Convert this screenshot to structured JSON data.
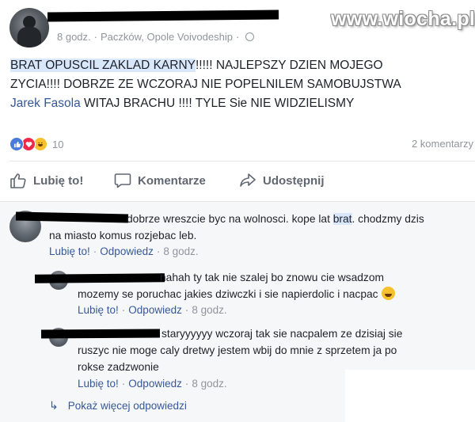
{
  "post": {
    "meta": {
      "time": "8 godz.",
      "separator": "·",
      "location": "Paczków, Opole Voivodeship",
      "extra_separator": "·"
    },
    "text": {
      "line1_highlight": "BRAT OPUSCIL ZAKLAD KARNY",
      "line1_rest": "!!!!! NAJLEPSZY DZIEN MOJEGO",
      "line2": "ZYCIA!!!! DOBRZE ZE WCZORAJ NIE POPELNILEM SAMOBUJSTWA",
      "line3_tag": "Jarek Fasola",
      "line3_rest": " WITAJ BRACHU !!!! TYLE Sie NIE WIDZIELISMY"
    },
    "reactions": {
      "icons": [
        "like-icon",
        "love-icon",
        "haha-icon"
      ],
      "count": "10"
    },
    "comments_count": "2 komentarzy"
  },
  "watermark": "www.wiocha.pl",
  "actions": {
    "like": "Lubię to!",
    "comment": "Komentarze",
    "share": "Udostępnij"
  },
  "comments": [
    {
      "line1_partial": "dobrze wreszcie byc na wolnosci. kope lat ",
      "line1_highlight": "brat",
      "line1_end": ". chodzmy dzis",
      "line2": "na miasto komus rozjebac leb.",
      "like": "Lubię to!",
      "reply": "Odpowiedz",
      "time": "8 godz."
    }
  ],
  "replies": [
    {
      "line1": "hahah ty tak nie szalej bo znowu cie wsadzom",
      "line2": "mozemy se poruchac jakies dziwczki i sie napierdolic i nacpac",
      "like": "Lubię to!",
      "reply": "Odpowiedz",
      "time": "8 godz."
    },
    {
      "line1": "staryyyyyy wczoraj tak sie nacpalem ze dzisiaj sie",
      "line2": "ruszyc nie moge caly dretwy jestem wbij do mnie z sprzetem ja po",
      "line3": "rokse zadzwonie",
      "like": "Lubię to!",
      "reply": "Odpowiedz",
      "time": "8 godz."
    }
  ],
  "more_replies": "Pokaż więcej odpowiedzi",
  "colors": {
    "link": "#365899",
    "meta": "#90949c",
    "text": "#1d2129",
    "highlight": "#d9e7fb",
    "comments_bg": "#f6f7f9"
  }
}
